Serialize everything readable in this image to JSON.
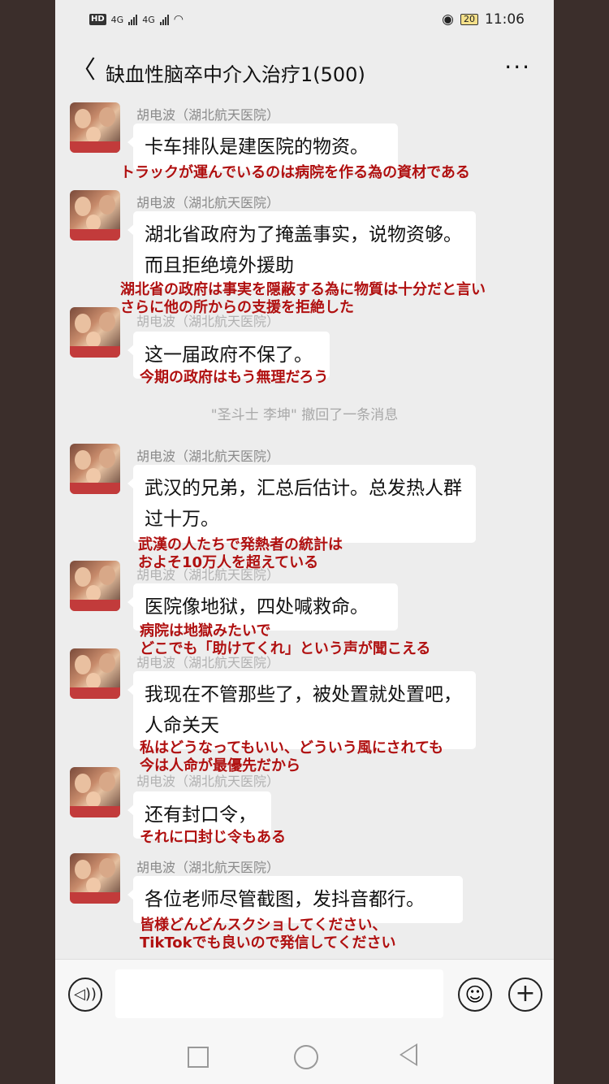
{
  "status_bar": {
    "hd_label": "HD",
    "net1": "4G",
    "net2": "4G",
    "battery": "20",
    "time": "11:06"
  },
  "header": {
    "title": "缺血性脑卒中介入治疗1(500)",
    "back_icon": "chevron-left-icon",
    "more_icon": "more-icon"
  },
  "sender_name": "胡电波（湖北航天医院）",
  "messages": [
    {
      "text": "卡车排队是建医院的物资。",
      "translation": [
        "トラックが運んでいるのは病院を作る為の資材である"
      ]
    },
    {
      "text": "湖北省政府为了掩盖事实，说物资够。而且拒绝境外援助",
      "translation": [
        "湖北省の政府は事実を隠蔽する為に物質は十分だと言い",
        "さらに他の所からの支援を拒絶した"
      ]
    },
    {
      "text": "这一届政府不保了。",
      "translation": [
        "今期の政府はもう無理だろう"
      ]
    },
    {
      "text": "武汉的兄弟，汇总后估计。总发热人群过十万。",
      "translation": [
        "武漢の人たちで発熱者の統計は",
        "およそ10万人を超えている"
      ]
    },
    {
      "text": "医院像地狱，四处喊救命。",
      "translation": [
        "病院は地獄みたいで",
        "どこでも「助けてくれ」という声が聞こえる"
      ]
    },
    {
      "text": "我现在不管那些了，被处置就处置吧，人命关天",
      "translation": [
        "私はどうなってもいい、どういう風にされても",
        "今は人命が最優先だから"
      ]
    },
    {
      "text": "还有封口令，",
      "translation": [
        "それに口封じ令もある"
      ]
    },
    {
      "text": "各位老师尽管截图，发抖音都行。",
      "translation": [
        "皆様どんどんスクショしてください、",
        "TikTokでも良いので発信してください"
      ]
    }
  ],
  "system_message": "\"圣斗士 李坤\" 撤回了一条消息",
  "input_bar": {
    "voice_icon": "voice-icon",
    "emoji_icon": "emoji-icon",
    "plus_icon": "plus-icon",
    "placeholder": ""
  },
  "nav_bar": {
    "icons": [
      "square-icon",
      "circle-icon",
      "back-triangle-icon"
    ]
  }
}
